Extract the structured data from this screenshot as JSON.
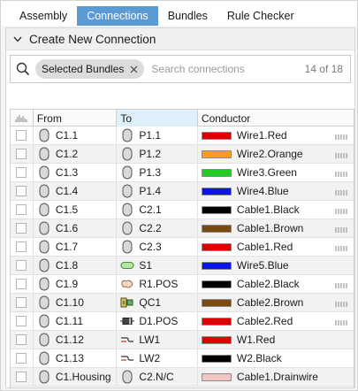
{
  "tabs": [
    {
      "label": "Assembly",
      "active": false
    },
    {
      "label": "Connections",
      "active": true
    },
    {
      "label": "Bundles",
      "active": false
    },
    {
      "label": "Rule Checker",
      "active": false
    }
  ],
  "section": {
    "title": "Create New Connection"
  },
  "search": {
    "chip_label": "Selected Bundles",
    "placeholder": "Search connections",
    "count": "14 of 18"
  },
  "table": {
    "columns": {
      "from": "From",
      "to": "To",
      "conductor": "Conductor"
    },
    "sorted_column": "to",
    "rows": [
      {
        "from": "C1.1",
        "from_icon": "connector-icon",
        "to": "P1.1",
        "to_icon": "connector-icon",
        "conductor": "Wire1.Red",
        "color": "#e00000",
        "bundle": true
      },
      {
        "from": "C1.2",
        "from_icon": "connector-icon",
        "to": "P1.2",
        "to_icon": "connector-icon",
        "conductor": "Wire2.Orange",
        "color": "#ff9a1a",
        "bundle": true
      },
      {
        "from": "C1.3",
        "from_icon": "connector-icon",
        "to": "P1.3",
        "to_icon": "connector-icon",
        "conductor": "Wire3.Green",
        "color": "#22cc22",
        "bundle": true
      },
      {
        "from": "C1.4",
        "from_icon": "connector-icon",
        "to": "P1.4",
        "to_icon": "connector-icon",
        "conductor": "Wire4.Blue",
        "color": "#0a14e6",
        "bundle": true
      },
      {
        "from": "C1.5",
        "from_icon": "connector-icon",
        "to": "C2.1",
        "to_icon": "connector-icon",
        "conductor": "Cable1.Black",
        "color": "#000000",
        "bundle": true
      },
      {
        "from": "C1.6",
        "from_icon": "connector-icon",
        "to": "C2.2",
        "to_icon": "connector-icon",
        "conductor": "Cable1.Brown",
        "color": "#7a4a12",
        "bundle": true
      },
      {
        "from": "C1.7",
        "from_icon": "connector-icon",
        "to": "C2.3",
        "to_icon": "connector-icon",
        "conductor": "Cable1.Red",
        "color": "#e00000",
        "bundle": true
      },
      {
        "from": "C1.8",
        "from_icon": "connector-icon",
        "to": "S1",
        "to_icon": "splice-icon",
        "conductor": "Wire5.Blue",
        "color": "#0a14e6",
        "bundle": false
      },
      {
        "from": "C1.9",
        "from_icon": "connector-icon",
        "to": "R1.POS",
        "to_icon": "component-icon",
        "conductor": "Cable2.Black",
        "color": "#000000",
        "bundle": true
      },
      {
        "from": "C1.10",
        "from_icon": "connector-icon",
        "to": "QC1",
        "to_icon": "quick-connect-icon",
        "conductor": "Cable2.Brown",
        "color": "#7a4a12",
        "bundle": true
      },
      {
        "from": "C1.11",
        "from_icon": "connector-icon",
        "to": "D1.POS",
        "to_icon": "diode-icon",
        "conductor": "Cable2.Red",
        "color": "#e00000",
        "bundle": true
      },
      {
        "from": "C1.12",
        "from_icon": "connector-icon",
        "to": "LW1",
        "to_icon": "loose-wire-icon",
        "conductor": "W1.Red",
        "color": "#e00000",
        "bundle": false
      },
      {
        "from": "C1.13",
        "from_icon": "connector-icon",
        "to": "LW2",
        "to_icon": "loose-wire-icon",
        "conductor": "W2.Black",
        "color": "#000000",
        "bundle": false
      },
      {
        "from": "C1.Housing",
        "from_icon": "connector-icon",
        "to": "C2.N/C",
        "to_icon": "connector-icon",
        "conductor": "Cable1.Drainwire",
        "color": "#f2c4c4",
        "bundle": false
      }
    ]
  }
}
